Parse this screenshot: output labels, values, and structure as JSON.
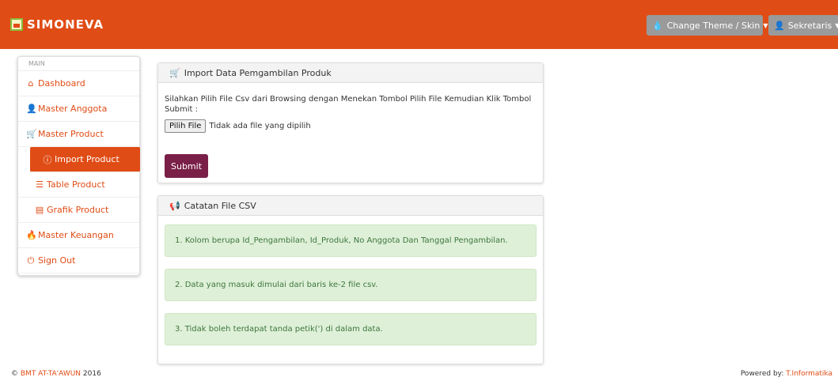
{
  "app": {
    "brand": "SIMONEVA"
  },
  "header": {
    "theme_button": "Change Theme / Skin",
    "user_button": "Sekretaris"
  },
  "sidebar": {
    "heading": "MAIN",
    "items": [
      {
        "label": "Dashboard",
        "icon": "home-icon"
      },
      {
        "label": "Master Anggota",
        "icon": "user-icon"
      },
      {
        "label": "Master Product",
        "icon": "cart-icon"
      },
      {
        "label": "Import Product",
        "icon": "info-circle-icon",
        "active": true
      },
      {
        "label": "Table Product",
        "icon": "list-icon"
      },
      {
        "label": "Grafik Product",
        "icon": "table-icon"
      },
      {
        "label": "Master Keuangan",
        "icon": "fire-icon"
      },
      {
        "label": "Sign Out",
        "icon": "power-icon"
      }
    ]
  },
  "import_panel": {
    "title": "Import Data Pemgambilan Produk",
    "instruction": "Silahkan Pilih File Csv dari Browsing dengan Menekan Tombol Pilih File Kemudian Klik Tombol Submit :",
    "file_button": "Pilih File",
    "file_status": "Tidak ada file yang dipilih",
    "submit": "Submit"
  },
  "notes_panel": {
    "title": "Catatan File CSV",
    "notes": [
      "1. Kolom berupa Id_Pengambilan, Id_Produk, No Anggota Dan Tanggal Pengambilan.",
      "2. Data yang masuk dimulai dari baris ke-2 file csv.",
      "3. Tidak boleh terdapat tanda petik(') di dalam data."
    ]
  },
  "footer": {
    "copyright_symbol": "©",
    "org": "BMT AT-TA'AWUN",
    "year": "2016",
    "powered_by": "Powered by:",
    "powered_link": "T.Informatika"
  },
  "colors": {
    "accent": "#e04c15",
    "submit": "#7a2048",
    "note_bg": "#dff0d8",
    "note_text": "#3c763d"
  }
}
